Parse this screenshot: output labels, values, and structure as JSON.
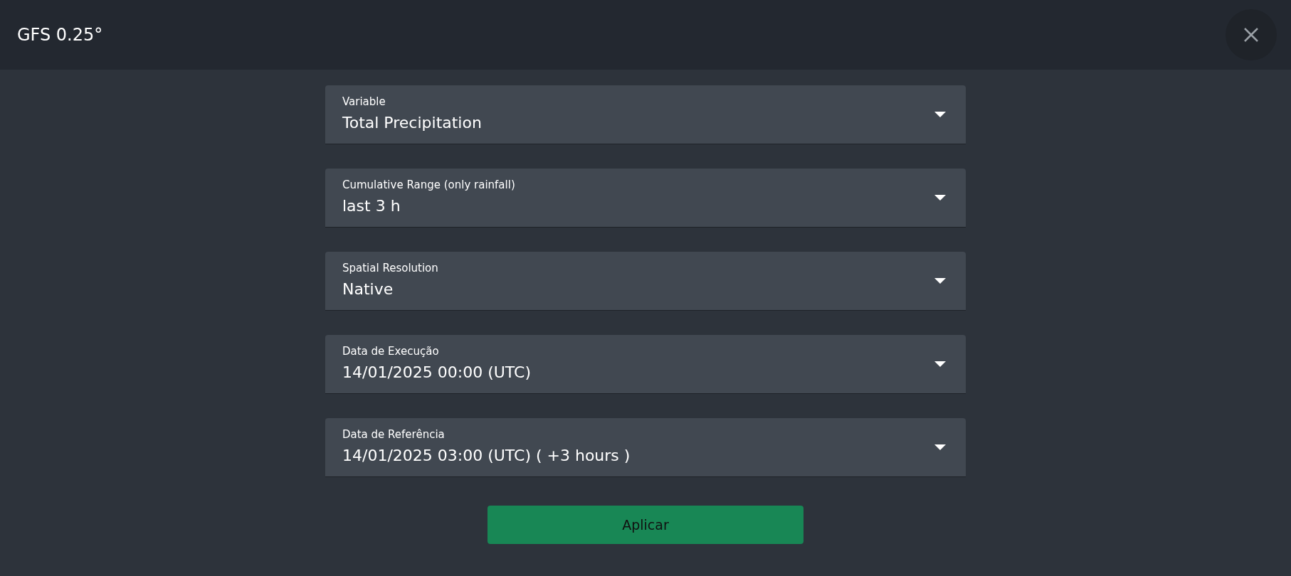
{
  "header": {
    "title": "GFS 0.25°"
  },
  "fields": [
    {
      "label": "Variable",
      "value": "Total Precipitation"
    },
    {
      "label": "Cumulative Range (only rainfall)",
      "value": "last 3 h"
    },
    {
      "label": "Spatial Resolution",
      "value": "Native"
    },
    {
      "label": "Data de Execução",
      "value": "14/01/2025 00:00 (UTC)"
    },
    {
      "label": "Data de Referência",
      "value": "14/01/2025 03:00 (UTC) ( +3 hours )"
    }
  ],
  "submit_button": {
    "label": "Aplicar"
  }
}
